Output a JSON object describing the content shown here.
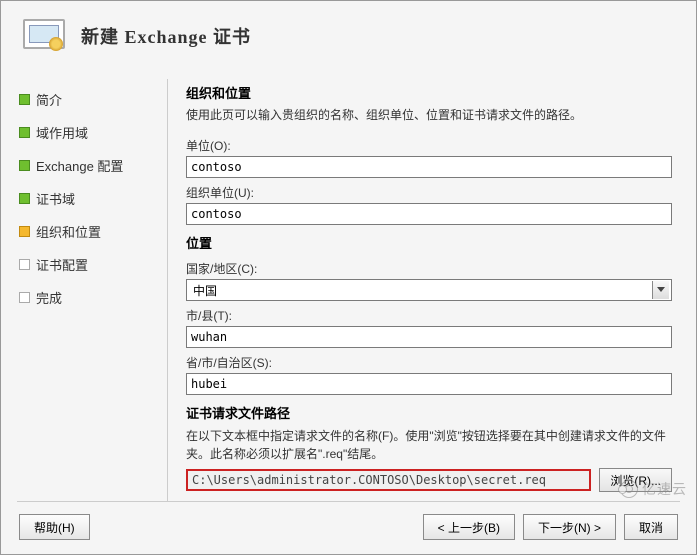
{
  "header": {
    "title": "新建 Exchange 证书"
  },
  "sidebar": {
    "items": [
      {
        "label": "简介",
        "state": "done"
      },
      {
        "label": "域作用域",
        "state": "done"
      },
      {
        "label": "Exchange 配置",
        "state": "done"
      },
      {
        "label": "证书域",
        "state": "done"
      },
      {
        "label": "组织和位置",
        "state": "current"
      },
      {
        "label": "证书配置",
        "state": "pending"
      },
      {
        "label": "完成",
        "state": "pending"
      }
    ]
  },
  "main": {
    "section_title": "组织和位置",
    "section_desc": "使用此页可以输入贵组织的名称、组织单位、位置和证书请求文件的路径。",
    "org_label": "单位(O):",
    "org_value": "contoso",
    "ou_label": "组织单位(U):",
    "ou_value": "contoso",
    "location_heading": "位置",
    "country_label": "国家/地区(C):",
    "country_value": "中国",
    "city_label": "市/县(T):",
    "city_value": "wuhan",
    "state_label": "省/市/自治区(S):",
    "state_value": "hubei",
    "path_heading": "证书请求文件路径",
    "path_note": "在以下文本框中指定请求文件的名称(F)。使用\"浏览\"按钮选择要在其中创建请求文件的文件夹。此名称必须以扩展名\".req\"结尾。",
    "path_value": "C:\\Users\\administrator.CONTOSO\\Desktop\\secret.req",
    "browse_label": "浏览(R)..."
  },
  "footer": {
    "help": "帮助(H)",
    "back": "< 上一步(B)",
    "next": "下一步(N) >",
    "cancel": "取消"
  },
  "watermark": "亿速云"
}
